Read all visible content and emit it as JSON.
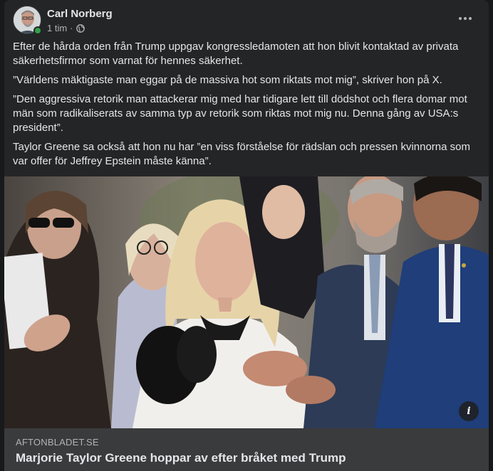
{
  "post": {
    "author": "Carl Norberg",
    "time": "1 tim",
    "separator": "·",
    "body": [
      "Efter de hårda orden från Trump uppgav kongressledamoten att hon blivit kontaktad av privata säkerhetsfirmor som varnat för hennes säkerhet.",
      "”Världens mäktigaste man eggar på de massiva hot som riktats mot mig”, skriver hon på X.",
      "”Den aggressiva retorik man attackerar mig med har tidigare lett till dödshot och flera domar mot män som radikaliserats av samma typ av retorik som riktas mot mig nu. Denna gång av USA:s president”.",
      "Taylor Greene sa också att hon nu har ”en viss förståelse för rädslan och pressen kvinnorna som var offer för Jeffrey Epstein måste känna”."
    ]
  },
  "link": {
    "domain": "AFTONBLADET.SE",
    "title": "Marjorie Taylor Greene hoppar av efter bråket med Trump",
    "info_glyph": "i"
  },
  "icons": {
    "audience": "globe-icon",
    "more": "more-options-icon",
    "info": "info-icon"
  },
  "colors": {
    "card_bg": "#242526",
    "link_bg": "#3a3b3c",
    "online": "#31a24c"
  }
}
